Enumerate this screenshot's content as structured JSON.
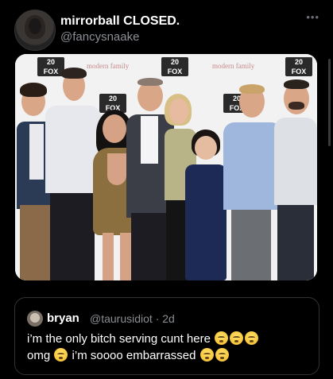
{
  "post": {
    "display_name": "mirrorball CLOSED.",
    "handle": "@fancysnaake",
    "more_icon": "more-dots-icon"
  },
  "photo": {
    "logo_text": "20\nFOX",
    "backdrop_text": "modern family"
  },
  "quoted_post": {
    "display_name": "bryan",
    "handle_and_time": "@taurusidiot · 2d",
    "line1": "i’m the only bitch serving cunt here",
    "line2_a": "omg",
    "line2_b": "i’m soooo embarrassed"
  },
  "colors": {
    "background": "#000000",
    "secondary_text": "#8b8f94",
    "border": "#2f3336"
  }
}
